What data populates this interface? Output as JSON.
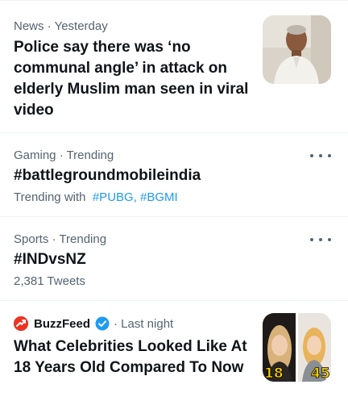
{
  "trends": [
    {
      "meta": "News · Yesterday",
      "headline_lines": [
        "Police say there was ‘no",
        "communal angle’ in attack on",
        "elderly Muslim man seen in viral",
        "video"
      ],
      "thumbnail": "elderly-man-photo"
    },
    {
      "meta": "Gaming · Trending",
      "headline": "#battlegroundmobileindia",
      "sub_prefix": "Trending with",
      "sub_tags": [
        "#PUBG,",
        "#BGMI"
      ],
      "more_icon": "more-dots-icon"
    },
    {
      "meta": "Sports · Trending",
      "headline": "#INDvsNZ",
      "sub": "2,381 Tweets",
      "more_icon": "more-dots-icon"
    },
    {
      "source": "BuzzFeed",
      "source_icon": "buzzfeed-logo-icon",
      "verified_icon": "verified-badge-icon",
      "time": "· Last night",
      "headline_lines": [
        "What Celebrities Looked Like At",
        "18 Years Old Compared To Now"
      ],
      "thumbnail": "celebrities-comparison-photo",
      "thumb_numbers": [
        "18",
        "45"
      ]
    }
  ],
  "colors": {
    "accent": "#1d9bf0",
    "secondary_text": "#536471",
    "primary_text": "#0f1419",
    "divider": "#eff3f4",
    "buzzfeed": "#ee3322"
  }
}
